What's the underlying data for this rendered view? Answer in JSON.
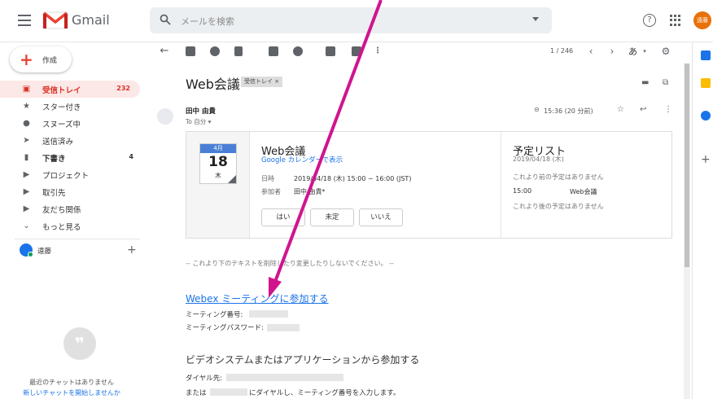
{
  "header": {
    "brand": "Gmail",
    "search_placeholder": "メールを検索",
    "avatar_text": "遠藤"
  },
  "sidebar": {
    "compose_label": "作成",
    "items": [
      {
        "label": "受信トレイ",
        "count": "232",
        "icon": "inbox-icon"
      },
      {
        "label": "スター付き",
        "count": "",
        "icon": "star-icon"
      },
      {
        "label": "スヌーズ中",
        "count": "",
        "icon": "clock-icon"
      },
      {
        "label": "送信済み",
        "count": "",
        "icon": "send-icon"
      },
      {
        "label": "下書き",
        "count": "4",
        "icon": "draft-icon"
      },
      {
        "label": "プロジェクト",
        "count": "",
        "icon": "label-icon"
      },
      {
        "label": "取引先",
        "count": "",
        "icon": "label-icon"
      },
      {
        "label": "友だち関係",
        "count": "",
        "icon": "label-icon"
      },
      {
        "label": "もっと見る",
        "count": "",
        "icon": "chevron-down-icon"
      }
    ],
    "hangouts_user": "遠藤",
    "no_chat": "最近のチャットはありません",
    "new_chat": "新しいチャットを開始しませんか"
  },
  "toolbar": {
    "pager": "1 / 246",
    "lang": "あ"
  },
  "message": {
    "subject": "Web会議",
    "label_chip": "受信トレイ ×",
    "sender": "田中 由貴",
    "to": "To 自分 ▾",
    "time": "15:36 (20 分前)"
  },
  "invite": {
    "cal_month": "4月",
    "cal_day": "18",
    "cal_weekday": "木",
    "title": "Web会議",
    "link": "Google カレンダーで表示",
    "when_label": "日時",
    "when_value": "2019/04/18 (木) 15:00 ~ 16:00 (JST)",
    "who_label": "参加者",
    "who_value": "田中 由貴*",
    "rsvp_yes": "はい",
    "rsvp_maybe": "未定",
    "rsvp_no": "いいえ",
    "agenda_title": "予定リスト",
    "agenda_date": "2019/04/18 (木)",
    "agenda_before": "これより前の予定はありません",
    "agenda_time": "15:00",
    "agenda_event": "Web会議",
    "agenda_after": "これより後の予定はありません"
  },
  "body": {
    "notice": "-- これより下のテキストを削除したり変更したりしないでください。 --",
    "webex_link": "Webex ミーティングに参加する",
    "meeting_number_label": "ミーティング番号:",
    "meeting_password_label": "ミーティングパスワード:",
    "section_title": "ビデオシステムまたはアプリケーションから参加する",
    "dial_label": "ダイヤル先:",
    "or_prefix": "または",
    "or_suffix": "にダイヤルし、ミーティング番号を入力します。"
  },
  "colors": {
    "gmail_red": "#ea4335",
    "link_blue": "#1a73e8",
    "arrow_magenta": "#d0148f",
    "active_bg": "#fce8e6"
  }
}
